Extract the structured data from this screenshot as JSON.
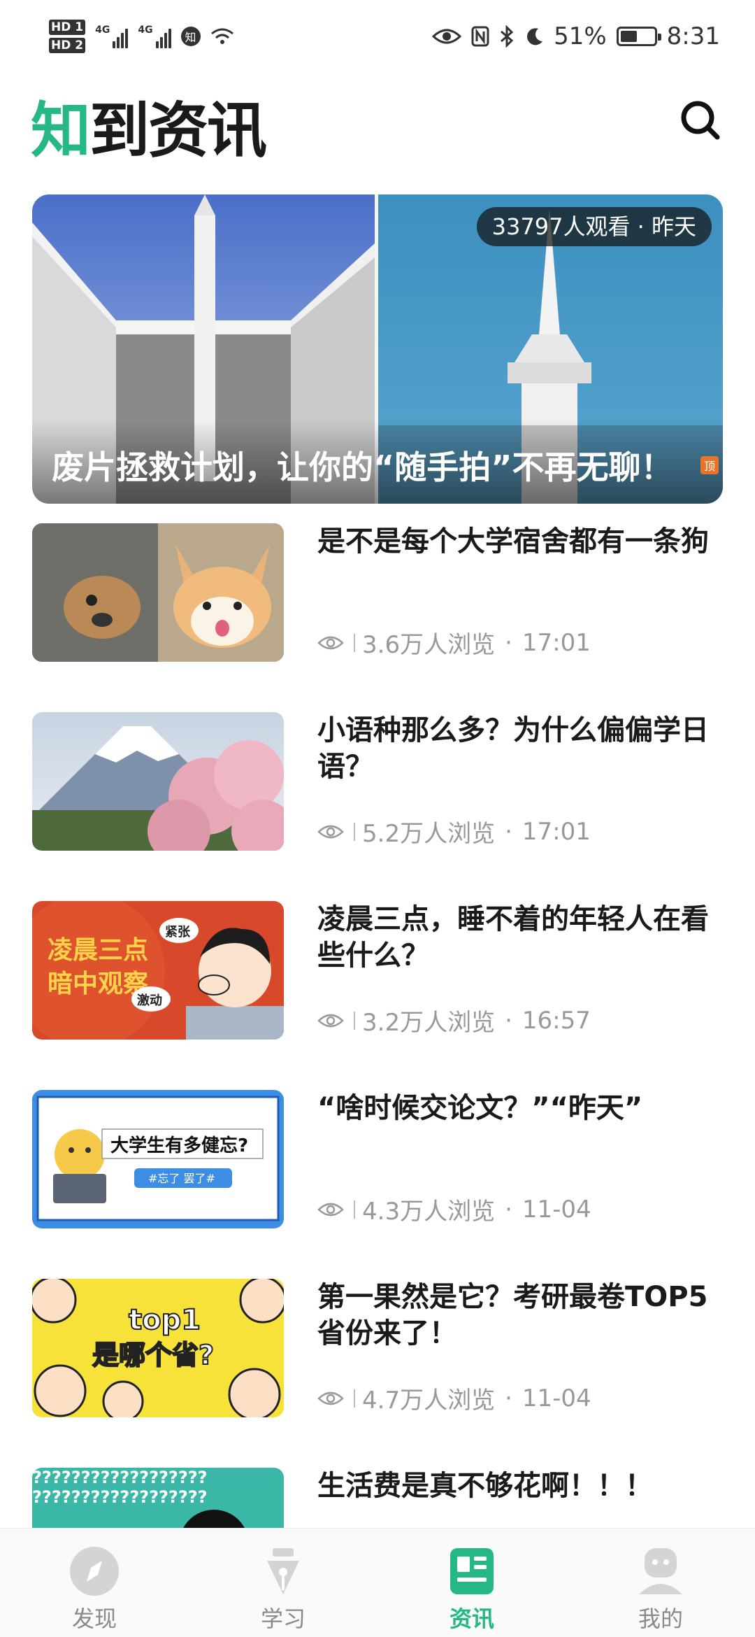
{
  "status_bar": {
    "hd1": "HD 1",
    "hd2": "HD 2",
    "net1": "4G",
    "net2": "4G",
    "zhi": "知",
    "battery_percent": "51%",
    "battery_level": 0.51,
    "time": "8:31"
  },
  "header": {
    "app_title_part1": "知",
    "app_title_part2": "到资讯"
  },
  "banner": {
    "view_count": "33797人观看 · 昨天",
    "title": "废片拯救计划，让你的“随手拍”不再无聊！",
    "top_tag": "顶"
  },
  "news": [
    {
      "title": "是不是每个大学宿舍都有一条狗",
      "views": "3.6万人浏览",
      "time": "17:01"
    },
    {
      "title": "小语种那么多？为什么偏偏学日语？",
      "views": "5.2万人浏览",
      "time": "17:01"
    },
    {
      "title": "凌晨三点，睡不着的年轻人在看些什么？",
      "views": "3.2万人浏览",
      "time": "16:57"
    },
    {
      "title": "“啥时候交论文？”“昨天”",
      "views": "4.3万人浏览",
      "time": "11-04"
    },
    {
      "title": "第一果然是它？考研最卷TOP5省份来了！",
      "views": "4.7万人浏览",
      "time": "11-04"
    },
    {
      "title": "生活费是真不够花啊！！！",
      "views": "",
      "time": ""
    }
  ],
  "thumb_text": {
    "t3_line1": "凌晨三点",
    "t3_line2": "暗中观察",
    "t3_tag1": "紧张",
    "t3_tag2": "激动",
    "t4_title": "大学生有多健忘?",
    "t4_tag": "#忘了 罢了#",
    "t5_line1": "top1",
    "t5_line2": "是哪个省?",
    "t6_line": "??????????????????"
  },
  "nav": {
    "items": [
      {
        "label": "发现",
        "active": false
      },
      {
        "label": "学习",
        "active": false
      },
      {
        "label": "资讯",
        "active": true
      },
      {
        "label": "我的",
        "active": false
      }
    ]
  },
  "colors": {
    "accent": "#25b886",
    "inactive": "#8a8a8a"
  }
}
